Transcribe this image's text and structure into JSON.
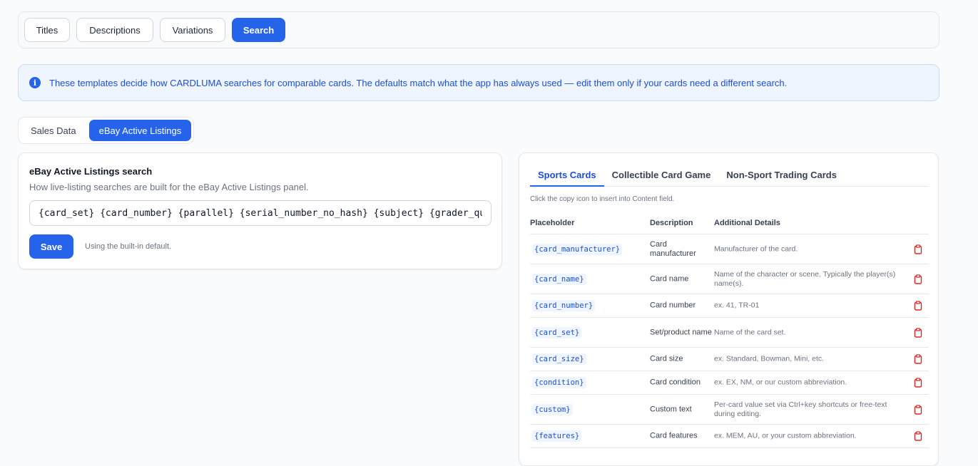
{
  "top_tabs": [
    "Titles",
    "Descriptions",
    "Variations",
    "Search"
  ],
  "top_tabs_active": "Search",
  "info_banner": "These templates decide how CARDLUMA searches for comparable cards. The defaults match what the app has always used — edit them only if your cards need a different search.",
  "sub_tabs": [
    "Sales Data",
    "eBay Active Listings"
  ],
  "search_card": {
    "title": "eBay Active Listings search",
    "subtitle": "How live-listing searches are built for the eBay Active Listings panel.",
    "template_value": "{card_set} {card_number} {parallel} {serial_number_no_hash} {subject} {grader_quality}",
    "save_label": "Save",
    "note": "Using the built-in default."
  },
  "placeholders": {
    "tabs": [
      "Sports Cards",
      "Collectible Card Game",
      "Non-Sport Trading Cards"
    ],
    "active_tab": "Sports Cards",
    "hint": "Click the copy icon to insert into Content field.",
    "columns": [
      "Placeholder",
      "Description",
      "Additional Details"
    ],
    "rows": [
      {
        "code": "{card_manufacturer}",
        "description": "Card manufacturer",
        "details": "Manufacturer of the card."
      },
      {
        "code": "{card_name}",
        "description": "Card name",
        "details": "Name of the character or scene. Typically the player(s) name(s)."
      },
      {
        "code": "{card_number}",
        "description": "Card number",
        "details": "ex. 41, TR-01"
      },
      {
        "code": "{card_set}",
        "description": "Set/product name",
        "details": "Name of the card set."
      },
      {
        "code": "{card_size}",
        "description": "Card size",
        "details": "ex. Standard, Bowman, Mini, etc."
      },
      {
        "code": "{condition}",
        "description": "Card condition",
        "details": "ex. EX, NM, or our custom abbreviation."
      },
      {
        "code": "{custom}",
        "description": "Custom text",
        "details": "Per-card value set via Ctrl+key shortcuts or free-text during editing."
      },
      {
        "code": "{features}",
        "description": "Card features",
        "details": "ex. MEM, AU, or your custom abbreviation."
      }
    ],
    "copy_icon": "clipboard-icon",
    "copy_icon_color": "#dc2626"
  },
  "colors": {
    "accent": "#2563eb",
    "banner_bg": "#eef5fe"
  }
}
